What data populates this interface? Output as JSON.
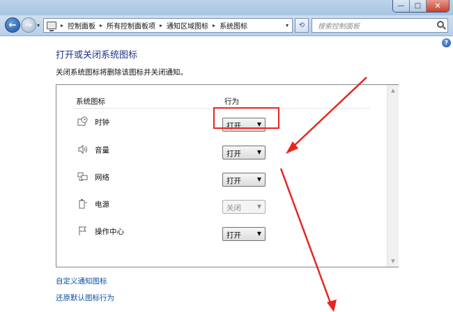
{
  "window": {
    "min_glyph": "—",
    "max_glyph": "□",
    "close_glyph": "✕"
  },
  "navbar": {
    "back_glyph": "←",
    "forward_glyph": "→",
    "breadcrumbs": [
      "控制面板",
      "所有控制面板项",
      "通知区域图标",
      "系统图标"
    ],
    "search_placeholder": "搜索控制面板"
  },
  "page": {
    "title": "打开或关闭系统图标",
    "description": "关闭系统图标将删除该图标并关闭通知。"
  },
  "table": {
    "header_icons": "系统图标",
    "header_behavior": "行为",
    "rows": [
      {
        "label": "时钟",
        "icon": "clock-icon",
        "value": "打开",
        "enabled": true
      },
      {
        "label": "音量",
        "icon": "volume-icon",
        "value": "打开",
        "enabled": true
      },
      {
        "label": "网络",
        "icon": "network-icon",
        "value": "打开",
        "enabled": true
      },
      {
        "label": "电源",
        "icon": "power-icon",
        "value": "关闭",
        "enabled": false
      },
      {
        "label": "操作中心",
        "icon": "flag-icon",
        "value": "打开",
        "enabled": true
      }
    ]
  },
  "links": {
    "customize": "自定义通知图标",
    "restore": "还原默认图标行为"
  },
  "colors": {
    "annotation": "#e6261f",
    "link": "#0a4fa1",
    "title": "#1e3287"
  }
}
